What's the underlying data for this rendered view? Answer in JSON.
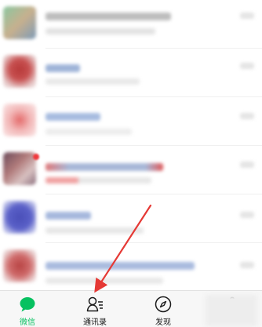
{
  "tabs": [
    {
      "label": "微信",
      "icon": "chat-bubble-icon",
      "active": true
    },
    {
      "label": "通讯录",
      "icon": "contacts-icon",
      "active": false
    },
    {
      "label": "发现",
      "icon": "compass-icon",
      "active": false
    }
  ],
  "colors": {
    "accent": "#07c160",
    "annotation_arrow": "#e53935",
    "badge": "#f0383c"
  }
}
